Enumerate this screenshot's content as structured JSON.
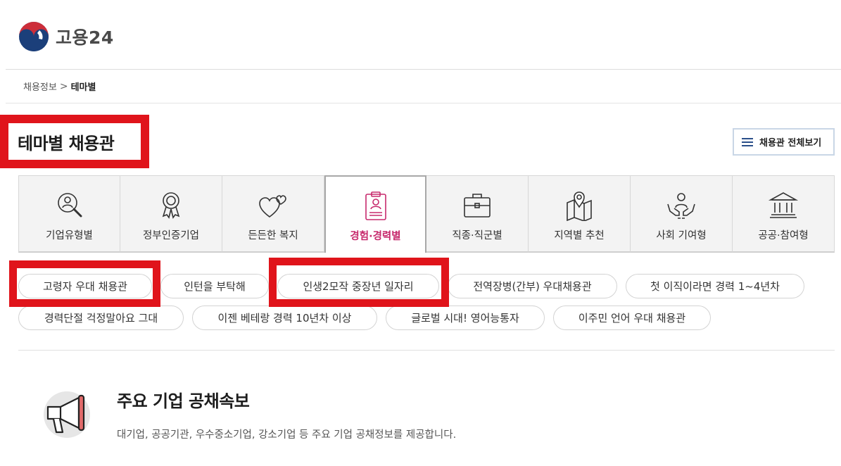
{
  "header": {
    "logo_text": "고용24"
  },
  "breadcrumb": {
    "parent": "채용정보",
    "separator": ">",
    "current": "테마별"
  },
  "page": {
    "title": "테마별 채용관",
    "all_button_label": "채용관 전체보기"
  },
  "tabs": [
    {
      "label": "기업유형별",
      "icon": "magnifier-person-icon",
      "active": false
    },
    {
      "label": "정부인증기업",
      "icon": "certificate-medal-icon",
      "active": false
    },
    {
      "label": "든든한 복지",
      "icon": "hearts-icon",
      "active": false
    },
    {
      "label": "경험·경력별",
      "icon": "clipboard-resume-icon",
      "active": true
    },
    {
      "label": "직종·직군별",
      "icon": "briefcase-icon",
      "active": false
    },
    {
      "label": "지역별 추천",
      "icon": "map-pin-icon",
      "active": false
    },
    {
      "label": "사회 기여형",
      "icon": "hands-person-icon",
      "active": false
    },
    {
      "label": "공공·참여형",
      "icon": "public-building-icon",
      "active": false
    }
  ],
  "chips": [
    {
      "label": "고령자 우대 채용관"
    },
    {
      "label": "인턴을 부탁해"
    },
    {
      "label": "인생2모작 중장년 일자리"
    },
    {
      "label": "전역장병(간부) 우대채용관"
    },
    {
      "label": "첫 이직이라면 경력 1~4년차"
    },
    {
      "label": "경력단절 걱정말아요 그대"
    },
    {
      "label": "이젠 베테랑 경력 10년차 이상"
    },
    {
      "label": "글로벌 시대! 영어능통자"
    },
    {
      "label": "이주민 언어 우대 채용관"
    }
  ],
  "promo": {
    "title": "주요 기업 공채속보",
    "description": "대기업, 공공기관, 우수중소기업, 강소기업 등 주요 기업 공채정보를 제공합니다.",
    "icon": "megaphone-icon"
  },
  "colors": {
    "highlight_red": "#e0141b",
    "active_tab_text": "#c72a6d",
    "logo_blue": "#1b3f7a",
    "logo_red": "#cd2e3a"
  }
}
